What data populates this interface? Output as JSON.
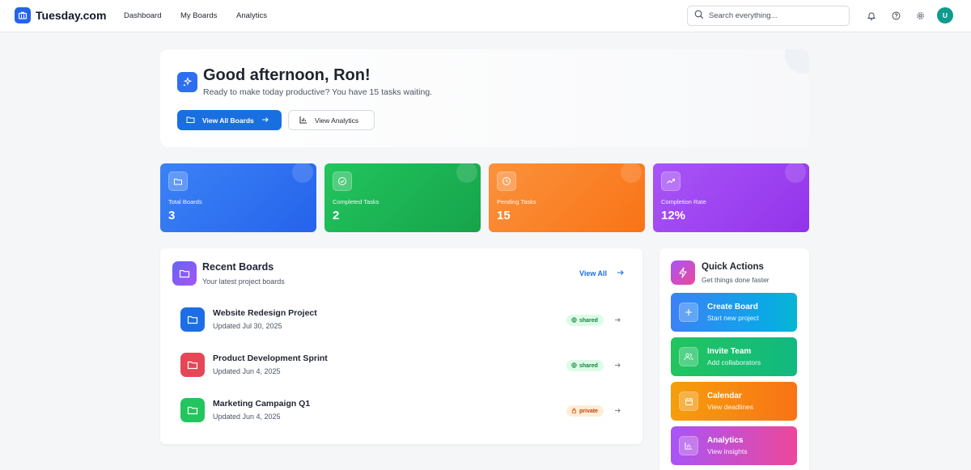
{
  "app": {
    "name": "Tuesday.com"
  },
  "nav": {
    "items": [
      "Dashboard",
      "My Boards",
      "Analytics"
    ]
  },
  "search": {
    "placeholder": "Search everything..."
  },
  "user": {
    "initial": "U"
  },
  "welcome": {
    "title": "Good afternoon, Ron!",
    "subtitle": "Ready to make today productive? You have 15 tasks waiting.",
    "primary_button": "View All Boards",
    "secondary_button": "View Analytics"
  },
  "stats": [
    {
      "label": "Total Boards",
      "value": "3",
      "color": "#2f6ff0",
      "icon": "folder-icon"
    },
    {
      "label": "Completed Tasks",
      "value": "2",
      "color": "#16a34a",
      "icon": "check-circle-icon"
    },
    {
      "label": "Pending Tasks",
      "value": "15",
      "color": "#f97316",
      "icon": "clock-icon"
    },
    {
      "label": "Completion Rate",
      "value": "12%",
      "color": "#9333ea",
      "icon": "trending-up-icon"
    }
  ],
  "recent_boards": {
    "title": "Recent Boards",
    "subtitle": "Your latest project boards",
    "view_all": "View All",
    "boards": [
      {
        "name": "Website Redesign Project",
        "updated": "Updated Jul 30, 2025",
        "visibility": "shared",
        "color": "#1d6ee6"
      },
      {
        "name": "Product Development Sprint",
        "updated": "Updated Jun 4, 2025",
        "visibility": "shared",
        "color": "#e54757"
      },
      {
        "name": "Marketing Campaign Q1",
        "updated": "Updated Jun 4, 2025",
        "visibility": "private",
        "color": "#22c55e"
      }
    ]
  },
  "quick_actions": {
    "title": "Quick Actions",
    "subtitle": "Get things done faster",
    "actions": [
      {
        "title": "Create Board",
        "subtitle": "Start new project",
        "icon": "plus-icon"
      },
      {
        "title": "Invite Team",
        "subtitle": "Add collaborators",
        "icon": "users-icon"
      },
      {
        "title": "Calendar",
        "subtitle": "View deadlines",
        "icon": "calendar-icon"
      },
      {
        "title": "Analytics",
        "subtitle": "View insights",
        "icon": "bar-chart-icon"
      }
    ]
  }
}
